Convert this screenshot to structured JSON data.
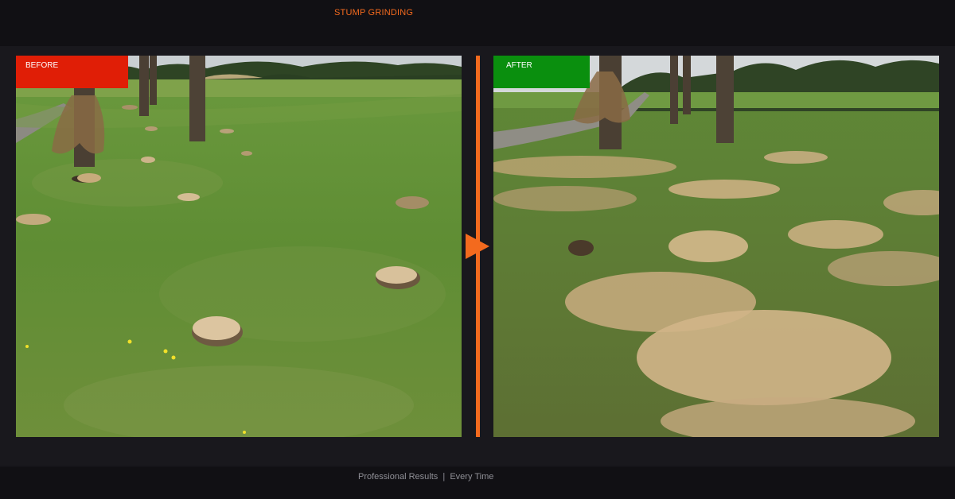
{
  "header": {
    "title": "STUMP GRINDING"
  },
  "before": {
    "label": "BEFORE"
  },
  "after": {
    "label": "AFTER"
  },
  "footer": {
    "tagline": "Professional Results  |  Every Time"
  },
  "colors": {
    "accent": "#f36a1e",
    "before_badge": "#e01e06",
    "after_badge": "#0a8f0e"
  },
  "icons": {
    "divider_arrow": "play-arrow-icon"
  }
}
